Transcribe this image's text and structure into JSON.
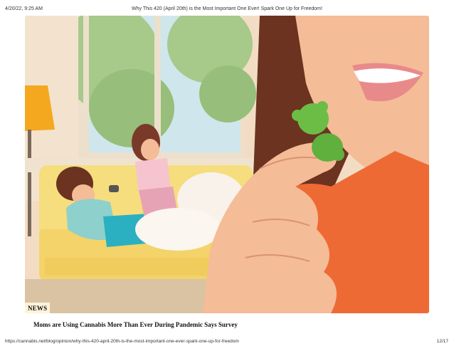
{
  "header": {
    "date": "4/20/22, 9:25 AM",
    "title": "Why This 420 (April 20th) is the Most Important One Ever! Spark One Up for Freedom!"
  },
  "hero": {
    "badge": "NEWS",
    "headline": "Moms are Using Cannabis More Than Ever During Pandemic Says Survey",
    "colors": {
      "wall": "#f2ddc4",
      "sofa": "#f6dd7e",
      "skin": "#f4bc97",
      "shirt": "#ee6a35",
      "hair": "#6b3320",
      "gummy": "#6cbd45",
      "lamp": "#f4a81f",
      "window": "#cfe6ec"
    }
  },
  "footer": {
    "url": "https://cannabis.net/blog/opinion/why-this-420-april-20th-is-the-most-important-one-ever-spark-one-up-for-freedom",
    "page": "12/17"
  }
}
